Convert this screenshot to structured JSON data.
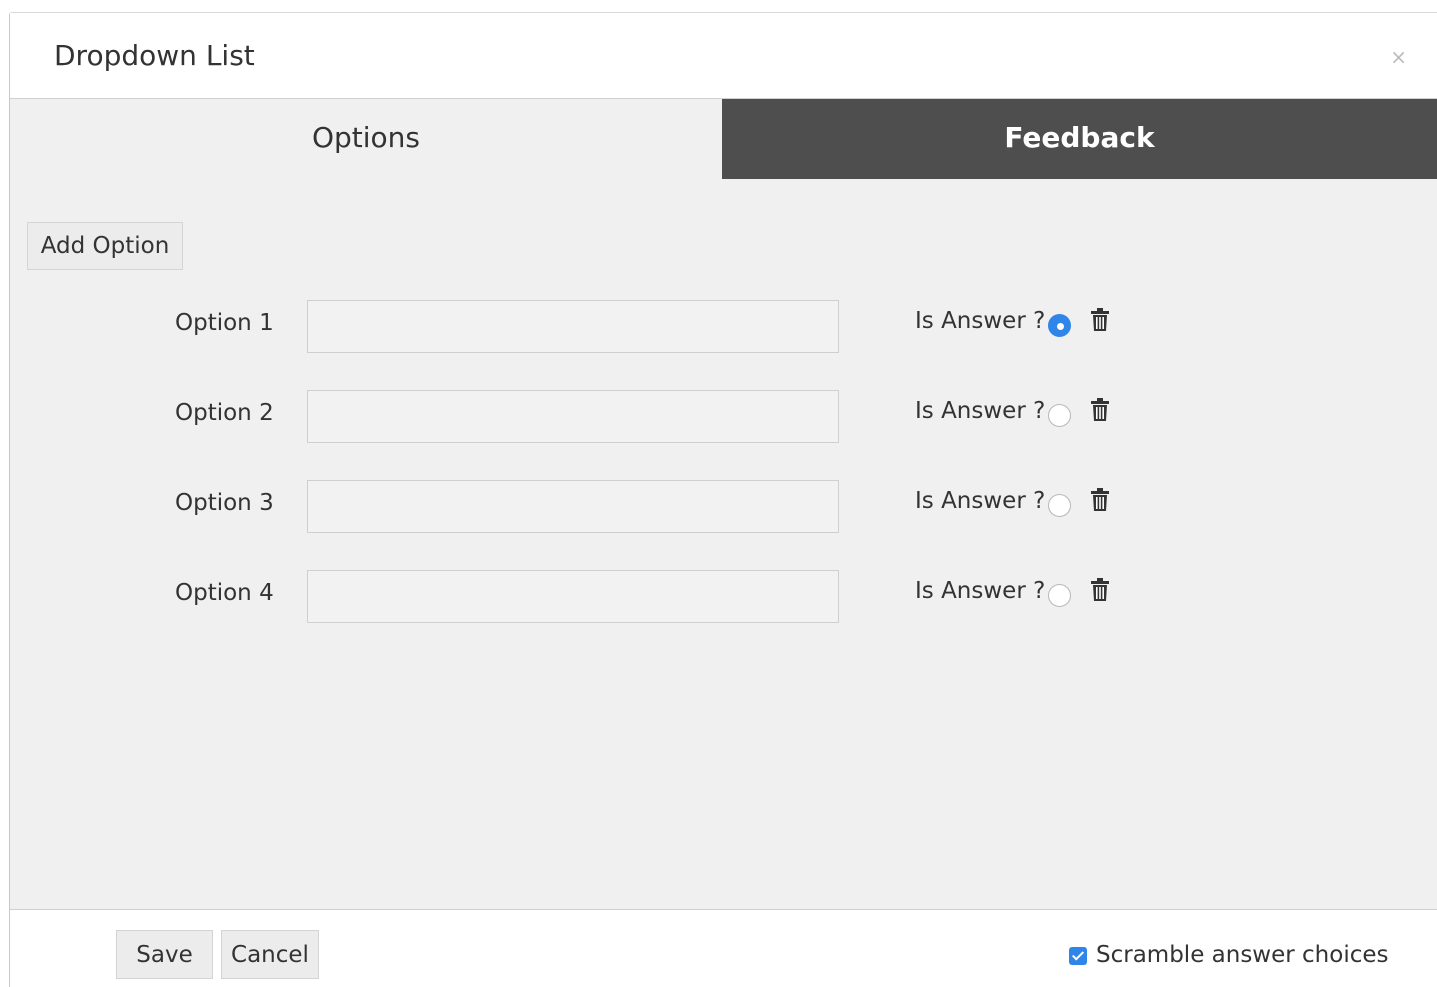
{
  "dialog": {
    "title": "Dropdown List",
    "close_symbol": "×"
  },
  "tabs": [
    {
      "label": "Options",
      "active": true
    },
    {
      "label": "Feedback",
      "active": false
    }
  ],
  "add_option_label": "Add Option",
  "options": [
    {
      "label": "Option 1",
      "value": "",
      "is_answer_label": "Is Answer ?",
      "is_answer": true
    },
    {
      "label": "Option 2",
      "value": "",
      "is_answer_label": "Is Answer ?",
      "is_answer": false
    },
    {
      "label": "Option 3",
      "value": "",
      "is_answer_label": "Is Answer ?",
      "is_answer": false
    },
    {
      "label": "Option 4",
      "value": "",
      "is_answer_label": "Is Answer ?",
      "is_answer": false
    }
  ],
  "footer": {
    "save_label": "Save",
    "cancel_label": "Cancel",
    "scramble_label": "Scramble answer choices",
    "scramble_checked": true
  },
  "colors": {
    "accent": "#2f86e8",
    "tab_inactive_bg": "#4e4e4e",
    "body_bg": "#f0f0f0"
  },
  "icons": {
    "close": "close-icon",
    "delete": "trash-icon",
    "checkbox": "checkbox-checked-icon"
  }
}
